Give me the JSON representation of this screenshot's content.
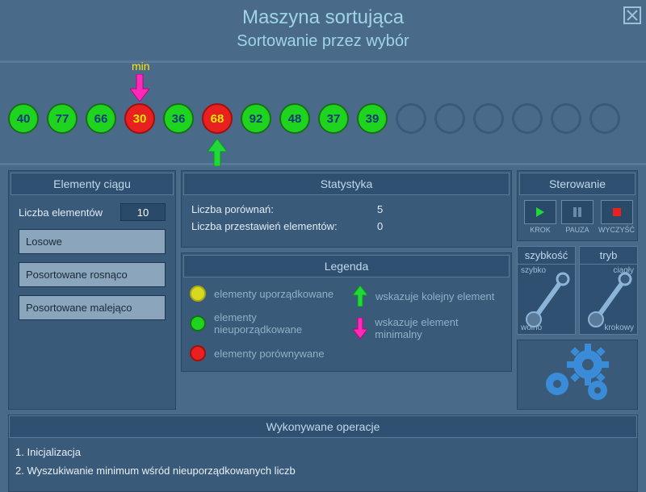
{
  "header": {
    "title": "Maszyna sortująca",
    "subtitle": "Sortowanie przez wybór"
  },
  "viz": {
    "min_label": "min",
    "min_index": 3,
    "cursor_index": 5,
    "items": [
      {
        "value": "40",
        "state": "green"
      },
      {
        "value": "77",
        "state": "green"
      },
      {
        "value": "66",
        "state": "green"
      },
      {
        "value": "30",
        "state": "red"
      },
      {
        "value": "36",
        "state": "green"
      },
      {
        "value": "68",
        "state": "red"
      },
      {
        "value": "92",
        "state": "green"
      },
      {
        "value": "48",
        "state": "green"
      },
      {
        "value": "37",
        "state": "green"
      },
      {
        "value": "39",
        "state": "green"
      },
      {
        "value": "",
        "state": "empty"
      },
      {
        "value": "",
        "state": "empty"
      },
      {
        "value": "",
        "state": "empty"
      },
      {
        "value": "",
        "state": "empty"
      },
      {
        "value": "",
        "state": "empty"
      },
      {
        "value": "",
        "state": "empty"
      }
    ]
  },
  "elements_panel": {
    "title": "Elementy ciągu",
    "count_label": "Liczba elementów",
    "count_value": "10",
    "btn_random": "Losowe",
    "btn_asc": "Posortowane rosnąco",
    "btn_desc": "Posortowane malejąco"
  },
  "stats_panel": {
    "title": "Statystyka",
    "comparisons_label": "Liczba porównań:",
    "comparisons_value": "5",
    "swaps_label": "Liczba przestawień elementów:",
    "swaps_value": "0"
  },
  "legend_panel": {
    "title": "Legenda",
    "sorted": "elementy uporządkowane",
    "unsorted": "elementy nieuporządkowane",
    "compared": "elementy porównywane",
    "next": "wskazuje kolejny element",
    "min": "wskazuje element minimalny"
  },
  "control_panel": {
    "title": "Sterowanie",
    "step_label": "KROK",
    "pause_label": "PAUZA",
    "clear_label": "WYCZYŚĆ"
  },
  "speed_panel": {
    "speed_title": "szybkość",
    "mode_title": "tryb",
    "fast": "szybko",
    "slow": "wolno",
    "continuous": "ciągły",
    "stepwise": "krokowy"
  },
  "ops_panel": {
    "title": "Wykonywane operacje",
    "steps": [
      "1. Inicjalizacja",
      "2. Wyszukiwanie minimum wśród nieuporządkowanych liczb"
    ]
  }
}
